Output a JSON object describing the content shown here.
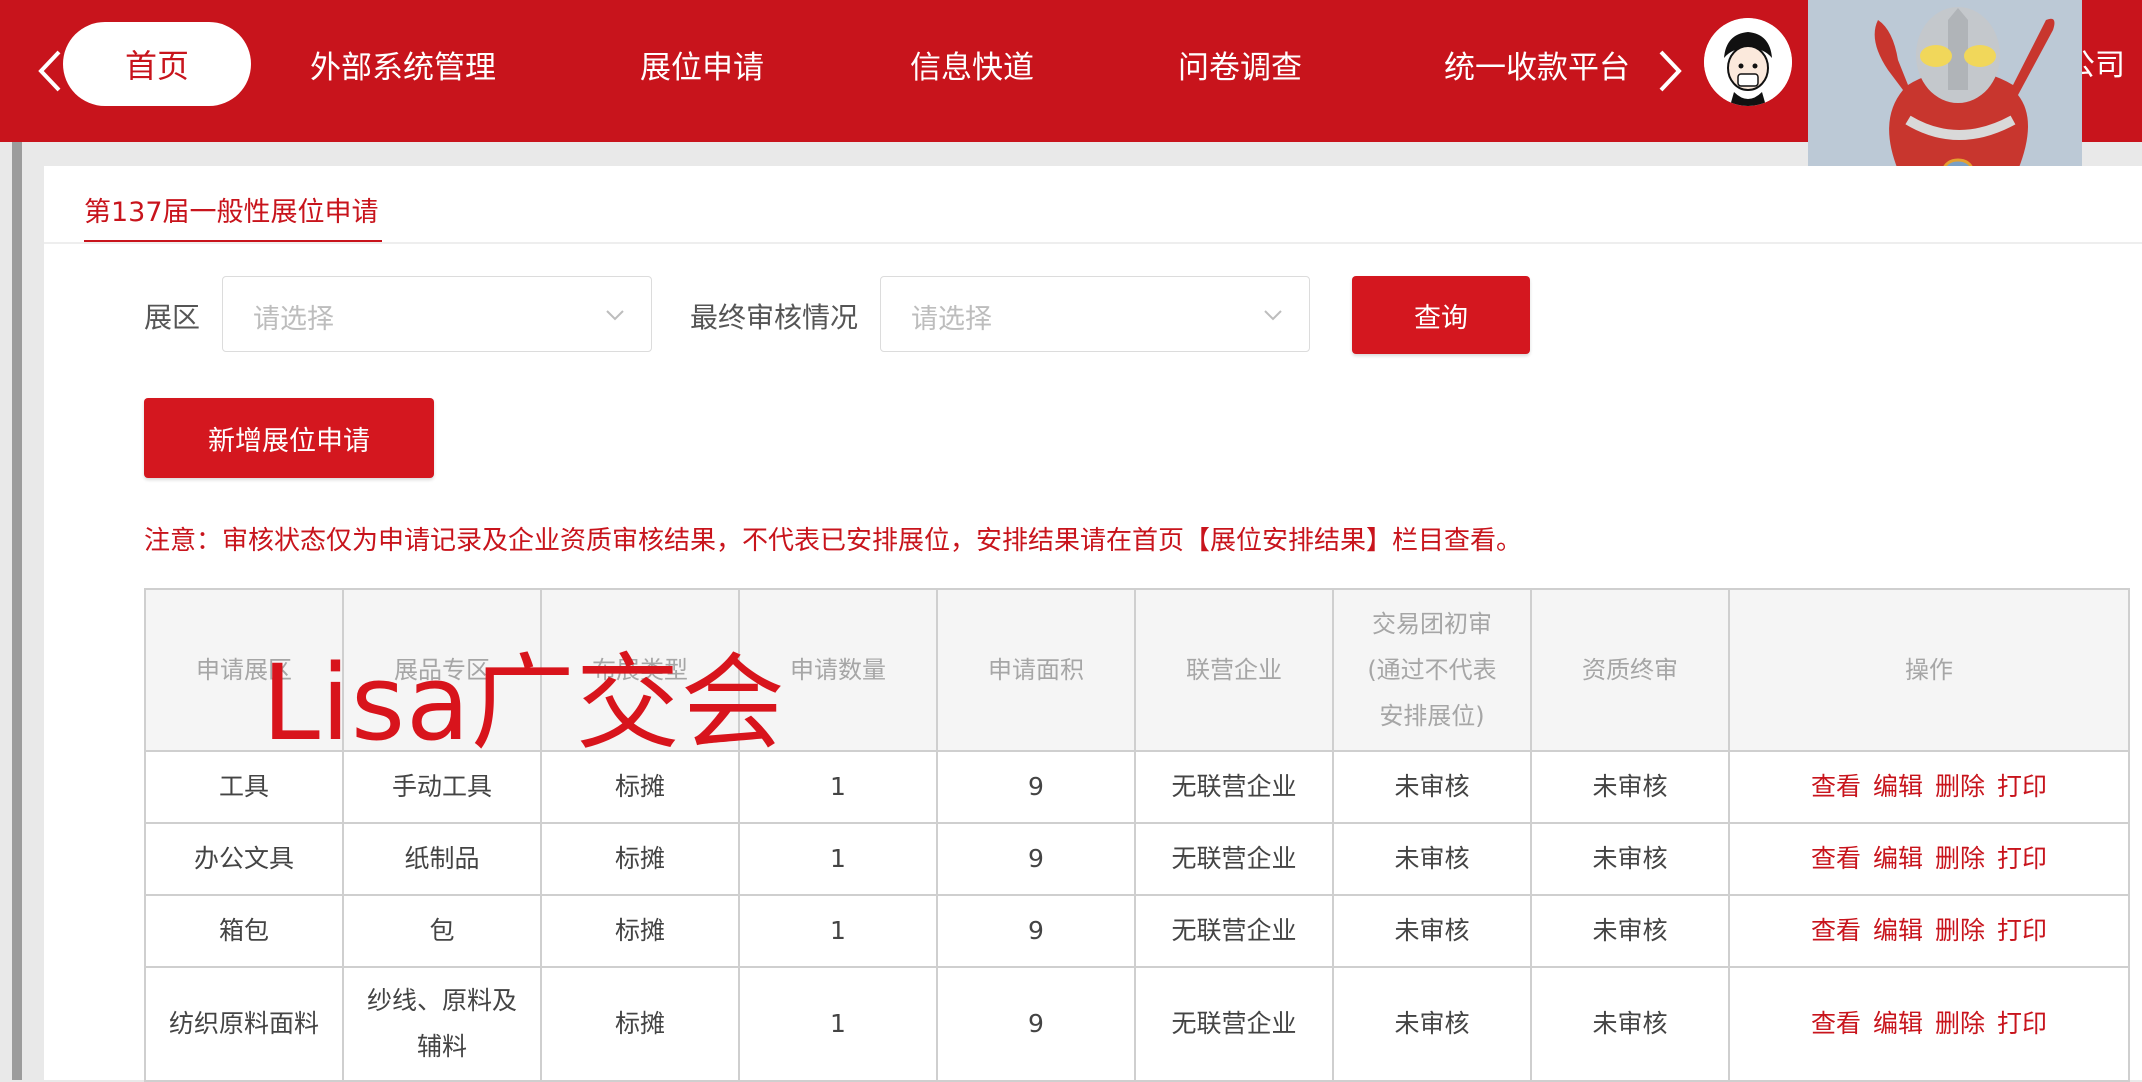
{
  "nav": {
    "home": "首页",
    "items": [
      "外部系统管理",
      "展位申请",
      "信息快道",
      "问卷调查",
      "统一收款平台"
    ],
    "company_fragment": "公司"
  },
  "tab": {
    "title": "第137届一般性展位申请"
  },
  "filters": {
    "zone_label": "展区",
    "zone_placeholder": "请选择",
    "review_label": "最终审核情况",
    "review_placeholder": "请选择",
    "query_button": "查询"
  },
  "add_button": "新增展位申请",
  "notice": "注意：审核状态仅为申请记录及企业资质审核结果，不代表已安排展位，安排结果请在首页【展位安排结果】栏目查看。",
  "table": {
    "headers": [
      "申请展区",
      "展品专区",
      "布展类型",
      "申请数量",
      "申请面积",
      "联营企业",
      "交易团初审(通过不代表安排展位)",
      "资质终审",
      "操作"
    ],
    "header_trade_lines": [
      "交易团初审",
      "(通过不代表",
      "安排展位)"
    ],
    "rows": [
      {
        "zone": "工具",
        "special": "手动工具",
        "type": "标摊",
        "qty": "1",
        "area": "9",
        "partner": "无联营企业",
        "initial": "未审核",
        "final": "未审核"
      },
      {
        "zone": "办公文具",
        "special": "纸制品",
        "type": "标摊",
        "qty": "1",
        "area": "9",
        "partner": "无联营企业",
        "initial": "未审核",
        "final": "未审核"
      },
      {
        "zone": "箱包",
        "special": "包",
        "type": "标摊",
        "qty": "1",
        "area": "9",
        "partner": "无联营企业",
        "initial": "未审核",
        "final": "未审核"
      },
      {
        "zone": "纺织原料面料",
        "special": "纱线、原料及辅料",
        "special_lines": [
          "纱线、原料及",
          "辅料"
        ],
        "type": "标摊",
        "qty": "1",
        "area": "9",
        "partner": "无联营企业",
        "initial": "未审核",
        "final": "未审核"
      }
    ],
    "actions": [
      "查看",
      "编辑",
      "删除",
      "打印"
    ]
  },
  "watermark": "Lisa广交会",
  "colors": {
    "brand_red": "#c8141c",
    "button_red": "#d4171f"
  },
  "icons": [
    "chevron-left-icon",
    "chevron-right-icon",
    "chevron-down-icon",
    "avatar"
  ]
}
